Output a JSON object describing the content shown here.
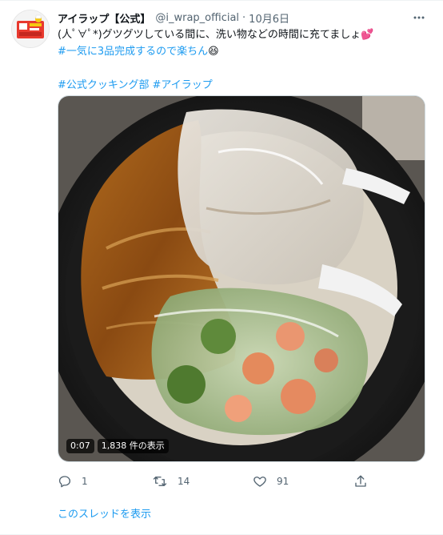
{
  "tweet": {
    "display_name": "アイラップ【公式】",
    "handle": "@i_wrap_official",
    "separator": "·",
    "date": "10月6日",
    "avatar_icon": "i-wrap-logo",
    "more_icon": "more-dots-icon",
    "text_line1": "(人ﾟ∀ﾟ*)グツグツしている間に、洗い物などの時間に充てましょ💕",
    "hashtag1": "#一気に3品完成するので楽ちん",
    "hashtag1_emoji": "😆",
    "hashtag2": "#公式クッキング部",
    "hashtag3": "#アイラップ",
    "media": {
      "duration": "0:07",
      "views": "1,838 件の表示"
    },
    "actions": {
      "reply_count": "1",
      "retweet_count": "14",
      "like_count": "91"
    },
    "thread_link": "このスレッドを表示"
  },
  "colors": {
    "link": "#1d9bf0",
    "secondary_text": "#536471",
    "primary_text": "#0f1419",
    "heart": "#e0245e"
  }
}
